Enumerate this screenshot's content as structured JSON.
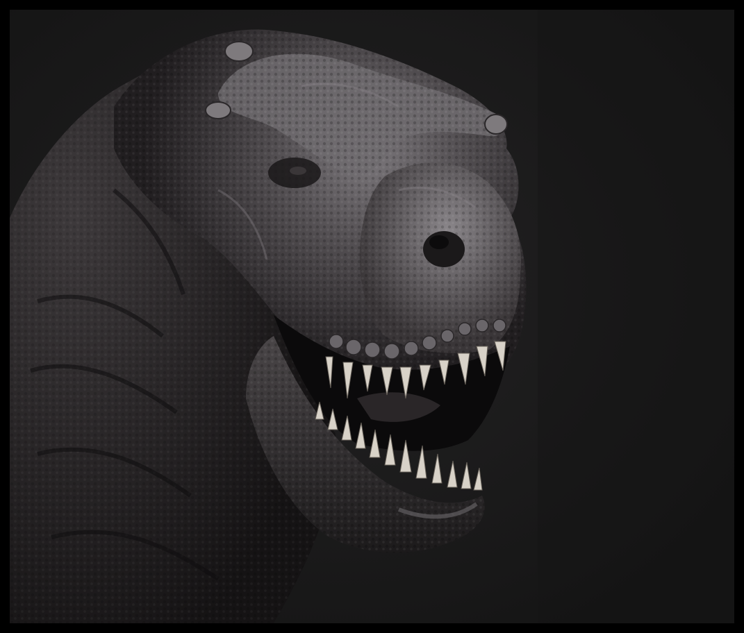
{
  "image": {
    "subject": "sculpted-dinosaur-head",
    "frame_color": "#000000",
    "background_color": "#1a1a1a",
    "skin_color_highlight": "#7a767a",
    "skin_color_mid": "#4a4648",
    "skin_color_shadow": "#221f21",
    "teeth_color": "#d8d2c8",
    "mouth_color": "#0b0a0b"
  }
}
